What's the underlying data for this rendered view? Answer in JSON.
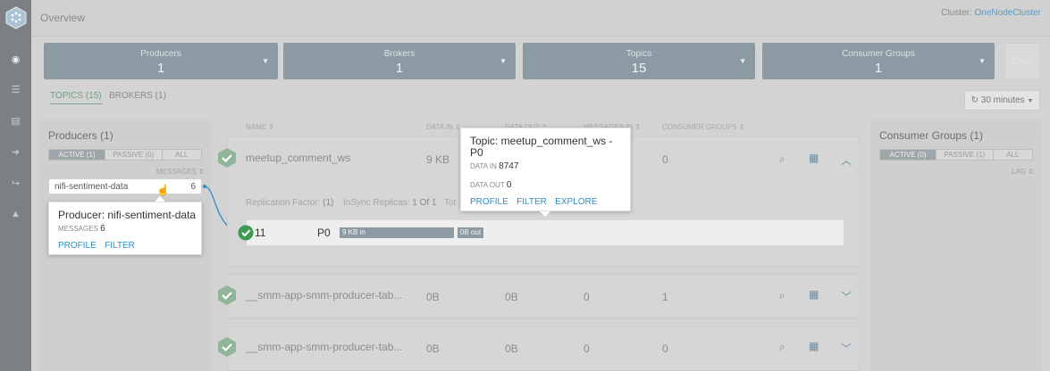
{
  "header": {
    "title": "Overview",
    "cluster_label": "Cluster:",
    "cluster_name": "OneNodeCluster"
  },
  "stats": [
    {
      "label": "Producers",
      "value": "1"
    },
    {
      "label": "Brokers",
      "value": "1"
    },
    {
      "label": "Topics",
      "value": "15"
    },
    {
      "label": "Consumer Groups",
      "value": "1"
    }
  ],
  "clear_label": "Clear",
  "tabs": [
    {
      "label": "TOPICS (15)",
      "active": true
    },
    {
      "label": "BROKERS (1)",
      "active": false
    }
  ],
  "time_range": "30 minutes",
  "producers": {
    "title": "Producers (1)",
    "filters": [
      "ACTIVE (1)",
      "PASSIVE (0)",
      "ALL"
    ],
    "sort_label": "MESSAGES",
    "items": [
      {
        "name": "nifi-sentiment-data",
        "count": "6"
      }
    ],
    "popover": {
      "title": "Producer: nifi-sentiment-data",
      "messages_label": "MESSAGES",
      "messages_value": "6",
      "links": [
        "PROFILE",
        "FILTER"
      ]
    }
  },
  "topics": {
    "columns": [
      "NAME",
      "DATA IN",
      "DATA OUT",
      "MESSAGES IN",
      "CONSUMER GROUPS"
    ],
    "rows": [
      {
        "name": "meetup_comment_ws",
        "data_in": "9 KB",
        "data_out": "",
        "messages_in": "",
        "consumer_groups": "0"
      },
      {
        "name": "__smm-app-smm-producer-tab...",
        "data_in": "0B",
        "data_out": "0B",
        "messages_in": "0",
        "consumer_groups": "1"
      },
      {
        "name": "__smm-app-smm-producer-tab...",
        "data_in": "0B",
        "data_out": "0B",
        "messages_in": "0",
        "consumer_groups": "0"
      }
    ],
    "detail": {
      "replication_label": "Replication Factor:",
      "replication_value": "(1)",
      "insync_label": "InSync Replicas:",
      "insync_value": "1 Of 1",
      "total_label": "Tot",
      "partition": {
        "broker": "11",
        "name": "P0",
        "in_label": "9 KB in",
        "out_label": "0B out",
        "in_fraction": 0.95
      }
    },
    "popover": {
      "title": "Topic: meetup_comment_ws - P0",
      "data_in_label": "DATA IN",
      "data_in_value": "8747",
      "data_out_label": "DATA OUT",
      "data_out_value": "0",
      "links": [
        "PROFILE",
        "FILTER",
        "EXPLORE"
      ]
    }
  },
  "consumer_groups": {
    "title": "Consumer Groups (1)",
    "filters": [
      "ACTIVE (0)",
      "PASSIVE (1)",
      "ALL"
    ],
    "sort_label": "LAG"
  },
  "colors": {
    "accent": "#2e8fc4",
    "stat_card": "#8c9aa3",
    "healthy": "#5aa974",
    "rail": "#7c7f84"
  }
}
